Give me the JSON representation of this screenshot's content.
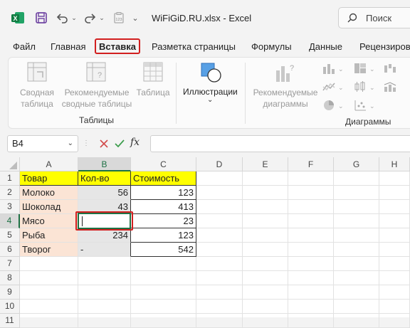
{
  "titlebar": {
    "file_title": "WiFiGiD.RU.xlsx  -  Excel",
    "search_label": "Поиск"
  },
  "tabs": [
    {
      "label": "Файл"
    },
    {
      "label": "Главная"
    },
    {
      "label": "Вставка",
      "active": true
    },
    {
      "label": "Разметка страницы"
    },
    {
      "label": "Формулы"
    },
    {
      "label": "Данные"
    },
    {
      "label": "Рецензиров"
    }
  ],
  "ribbon": {
    "groups": {
      "tables": "Таблицы",
      "charts": "Диаграммы"
    },
    "buttons": {
      "pivot_table": "Сводная таблица",
      "recommended_pivot": "Рекомендуемые сводные таблицы",
      "table": "Таблица",
      "illustrations": "Иллюстрации",
      "recommended_charts": "Рекомендуемые диаграммы"
    }
  },
  "formula_bar": {
    "name_box": "B4",
    "fx": "fx",
    "value": ""
  },
  "grid": {
    "columns": [
      "A",
      "B",
      "C",
      "D",
      "E",
      "F",
      "G",
      "H"
    ],
    "rows": [
      "1",
      "2",
      "3",
      "4",
      "5",
      "6",
      "7",
      "8",
      "9",
      "10",
      "11"
    ],
    "cells": [
      [
        "Товар",
        "Кол-во",
        "Стоимость"
      ],
      [
        "Молоко",
        "56",
        "123"
      ],
      [
        "Шоколад",
        "43",
        "413"
      ],
      [
        "Мясо",
        "",
        "23"
      ],
      [
        "Рыба",
        "234",
        "123"
      ],
      [
        "Творог",
        "-",
        "542"
      ]
    ],
    "selected_cell": "B4",
    "colors": {
      "header_fill": "#ffff00",
      "column_a_fill": "#fbe4d5",
      "column_b_fill": "#e6e6e6",
      "selection_outline": "#d21f1f",
      "excel_green": "#1e7145"
    }
  }
}
